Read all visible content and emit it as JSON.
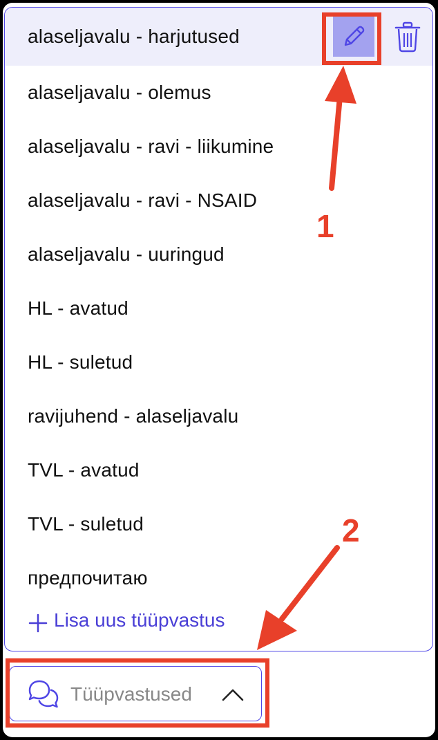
{
  "dropdown": {
    "items": [
      {
        "label": "alaseljavalu - harjutused",
        "active": true
      },
      {
        "label": "alaseljavalu - olemus"
      },
      {
        "label": "alaseljavalu - ravi - liikumine"
      },
      {
        "label": "alaseljavalu - ravi - NSAID"
      },
      {
        "label": "alaseljavalu - uuringud"
      },
      {
        "label": "HL - avatud"
      },
      {
        "label": "HL - suletud"
      },
      {
        "label": "ravijuhend - alaseljavalu"
      },
      {
        "label": "TVL - avatud"
      },
      {
        "label": "TVL - suletud"
      },
      {
        "label": "предпочитаю"
      }
    ],
    "add_label": "Lisa uus tüüpvastus",
    "edit_icon": "pencil-icon",
    "delete_icon": "trash-icon"
  },
  "toggle": {
    "label": "Tüüpvastused",
    "icon": "chat-bubbles-icon",
    "chevron": "chevron-up-icon"
  },
  "annotations": {
    "marker_1": "1",
    "marker_2": "2",
    "color": "#e8402a"
  },
  "colors": {
    "accent": "#4f46e5",
    "active_row": "#eeeefb",
    "edit_button": "#a3a2ef"
  }
}
